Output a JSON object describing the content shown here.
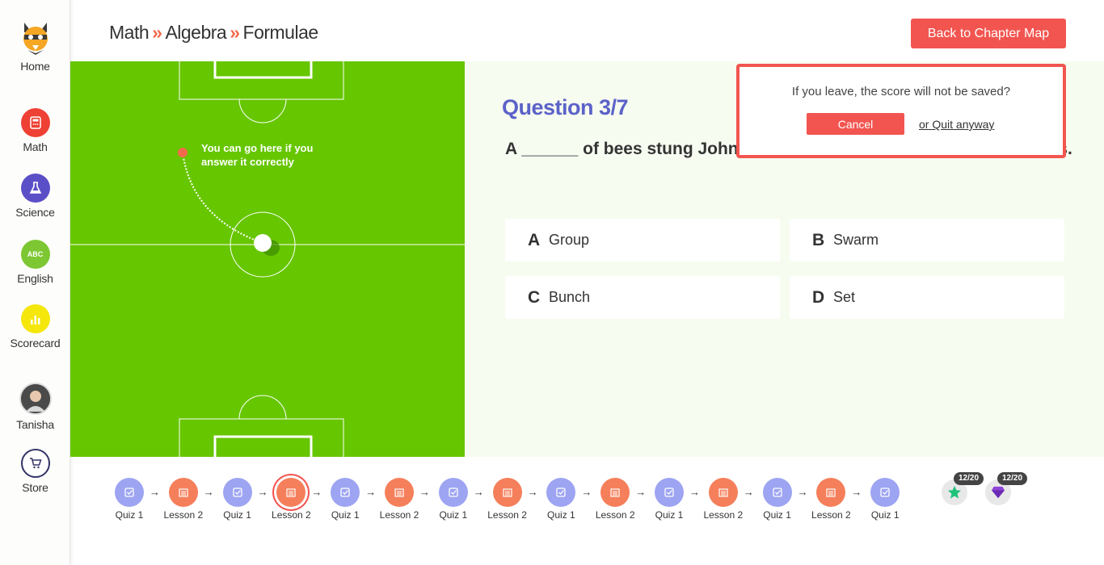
{
  "sidebar": {
    "items": [
      {
        "label": "Home",
        "icon": "home-owl-icon",
        "color": "#f5a623"
      },
      {
        "label": "Math",
        "icon": "calculator-icon",
        "color": "#ee4035"
      },
      {
        "label": "Science",
        "icon": "flask-icon",
        "color": "#5b4fc8"
      },
      {
        "label": "English",
        "icon": "abc-icon",
        "icon_text": "ABC",
        "color": "#7dc733"
      },
      {
        "label": "Scorecard",
        "icon": "bar-chart-icon",
        "color": "#f5d90c"
      },
      {
        "label": "Tanisha",
        "icon": "avatar"
      },
      {
        "label": "Store",
        "icon": "cart-icon",
        "color": "#333366"
      }
    ]
  },
  "header": {
    "breadcrumb": [
      "Math",
      "Algebra",
      "Formulae"
    ],
    "separator": "»",
    "back_button": "Back to Chapter Map"
  },
  "field": {
    "hint": "You can go here if you answer it correctly",
    "color": "#66c600"
  },
  "question": {
    "title": "Question 3/7",
    "text": "A ______ of bees stung Johnny ...................................... he already was.",
    "options": [
      {
        "letter": "A",
        "text": "Group"
      },
      {
        "letter": "B",
        "text": "Swarm"
      },
      {
        "letter": "C",
        "text": "Bunch"
      },
      {
        "letter": "D",
        "text": "Set"
      }
    ]
  },
  "modal": {
    "message": "If you leave, the score will not be saved?",
    "cancel": "Cancel",
    "quit": "or Quit anyway"
  },
  "progress": {
    "steps": [
      {
        "type": "quiz",
        "label": "Quiz 1"
      },
      {
        "type": "lesson",
        "label": "Lesson 2"
      },
      {
        "type": "quiz",
        "label": "Quiz 1"
      },
      {
        "type": "lesson",
        "label": "Lesson 2",
        "current": true
      },
      {
        "type": "quiz",
        "label": "Quiz 1"
      },
      {
        "type": "lesson",
        "label": "Lesson 2"
      },
      {
        "type": "quiz",
        "label": "Quiz 1"
      },
      {
        "type": "lesson",
        "label": "Lesson 2"
      },
      {
        "type": "quiz",
        "label": "Quiz 1"
      },
      {
        "type": "lesson",
        "label": "Lesson 2"
      },
      {
        "type": "quiz",
        "label": "Quiz 1"
      },
      {
        "type": "lesson",
        "label": "Lesson 2"
      },
      {
        "type": "quiz",
        "label": "Quiz 1"
      },
      {
        "type": "lesson",
        "label": "Lesson 2"
      },
      {
        "type": "quiz",
        "label": "Quiz 1"
      }
    ]
  },
  "rewards": {
    "stars": "12/20",
    "gems": "12/20"
  },
  "colors": {
    "accent": "#f25550",
    "question_title": "#5b62c8",
    "quiz_dot": "#9da4f2",
    "lesson_dot": "#f57f5b"
  }
}
